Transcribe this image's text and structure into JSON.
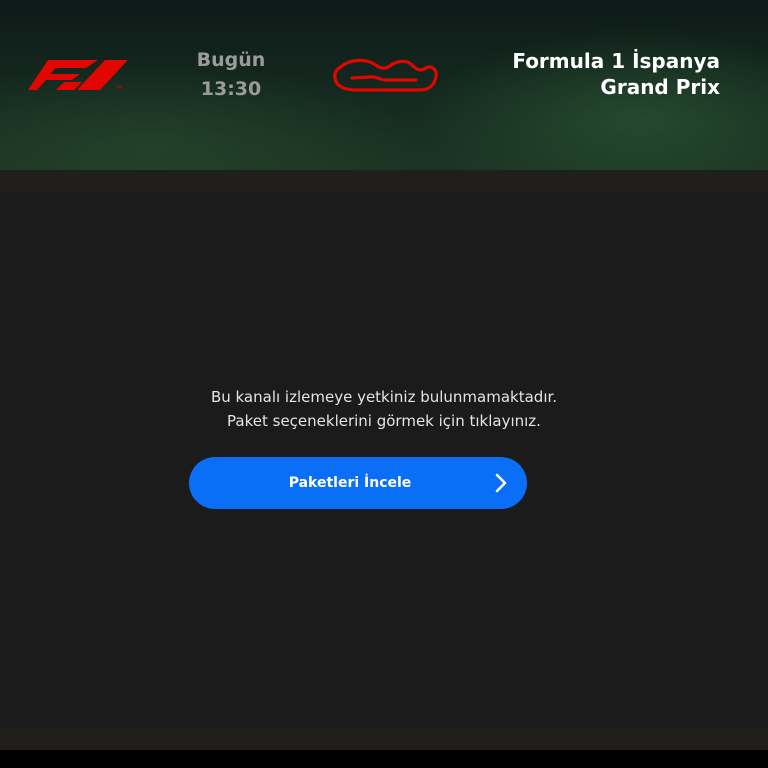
{
  "header": {
    "logo_icon": "f1-logo-icon",
    "day_label": "Bugün",
    "time": "13:30",
    "track_icon": "circuit-layout-icon",
    "event_title_line1": "Formula 1 İspanya",
    "event_title_line2": "Grand Prix"
  },
  "main": {
    "message_line1": "Bu kanalı izlemeye yetkiniz bulunmamaktadır.",
    "message_line2": "Paket seçeneklerini görmek için tıklayınız.",
    "cta_label": "Paketleri İncele",
    "cta_icon": "chevron-right-icon"
  },
  "colors": {
    "brand_red": "#e10600",
    "cta_blue": "#0b6ef7",
    "background": "#1b1b1b",
    "header_green": "#1b3524",
    "muted_text": "#9b9b9b"
  }
}
